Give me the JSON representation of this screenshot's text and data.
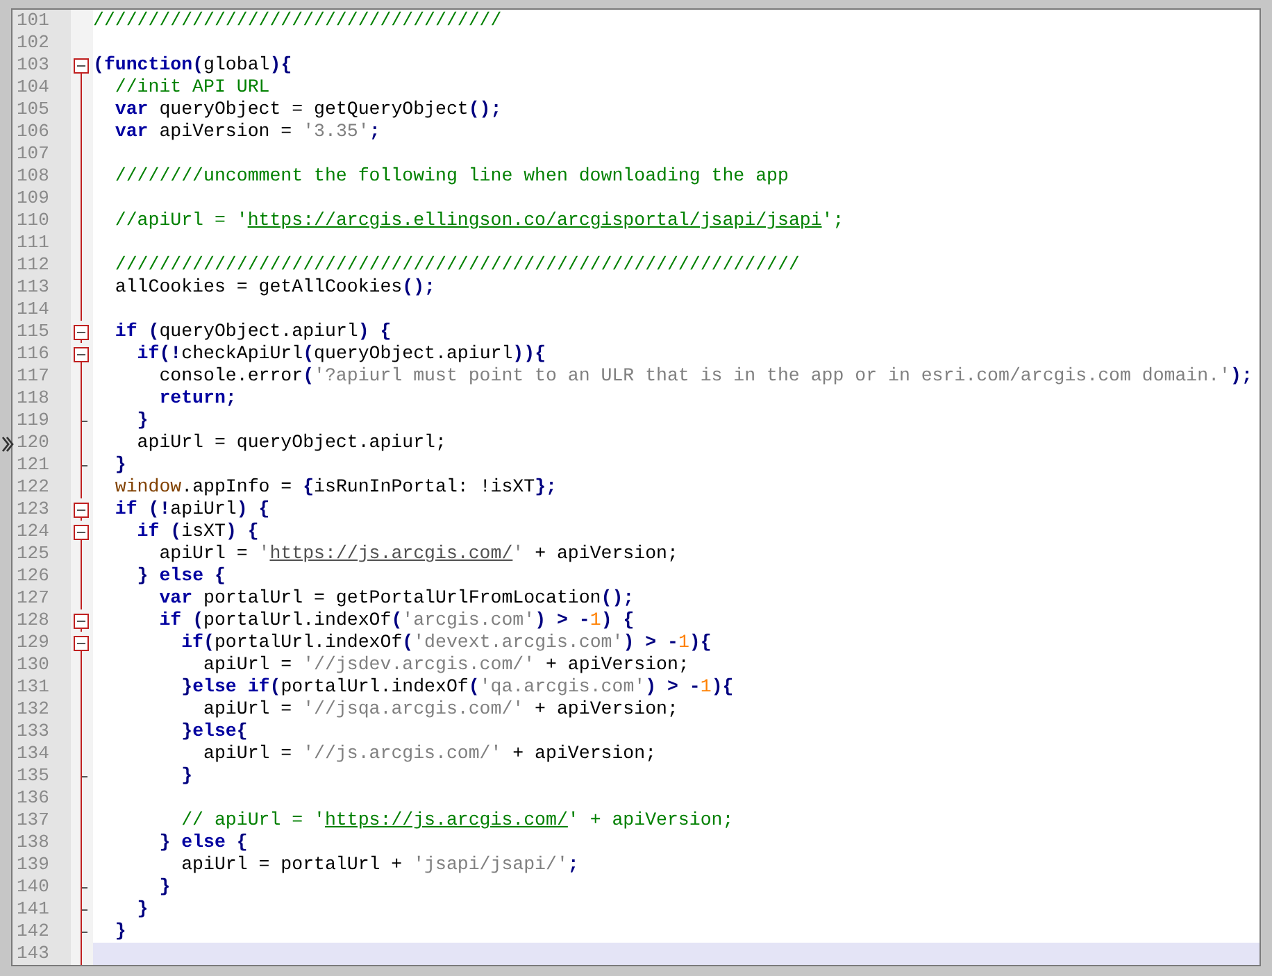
{
  "editor": {
    "lines": [
      {
        "number": "101",
        "kind": "outside",
        "current": false,
        "tokens": [
          {
            "kind": "comment",
            "text": "/////////////////////////////////////"
          }
        ]
      },
      {
        "number": "102",
        "kind": "outside",
        "current": false
      },
      {
        "number": "103",
        "kind": "start",
        "current": false,
        "tokens": [
          {
            "kind": "punct",
            "text": "("
          },
          {
            "kind": "keyword",
            "text": "function"
          },
          {
            "kind": "punct",
            "text": "("
          },
          {
            "kind": "ident",
            "text": "global"
          },
          {
            "kind": "punct",
            "text": "){"
          }
        ]
      },
      {
        "number": "104",
        "kind": "body",
        "current": false,
        "tokens": [
          {
            "kind": "comment",
            "text": "  //init API URL"
          }
        ]
      },
      {
        "number": "105",
        "kind": "body",
        "current": false,
        "tokens": [
          {
            "kind": "keyword",
            "text": "  var"
          },
          {
            "kind": "ident",
            "text": " queryObject = getQueryObject"
          },
          {
            "kind": "punct",
            "text": "();"
          }
        ]
      },
      {
        "number": "106",
        "kind": "body",
        "current": false,
        "tokens": [
          {
            "kind": "keyword",
            "text": "  var"
          },
          {
            "kind": "ident",
            "text": " apiVersion = "
          },
          {
            "kind": "string",
            "text": "'3.35'"
          },
          {
            "kind": "punct",
            "text": ";"
          }
        ]
      },
      {
        "number": "107",
        "kind": "body",
        "current": false
      },
      {
        "number": "108",
        "kind": "body",
        "current": false,
        "tokens": [
          {
            "kind": "comment",
            "text": "  ////////uncomment the following line when downloading the app"
          }
        ]
      },
      {
        "number": "109",
        "kind": "body",
        "current": false
      },
      {
        "number": "110",
        "kind": "body",
        "current": false,
        "tokens": [
          {
            "kind": "comment",
            "text": "  //apiUrl = '"
          },
          {
            "kind": "comment-url",
            "text": "https://arcgis.ellingson.co/arcgisportal/jsapi/jsapi"
          },
          {
            "kind": "comment",
            "text": "';"
          }
        ]
      },
      {
        "number": "111",
        "kind": "body",
        "current": false
      },
      {
        "number": "112",
        "kind": "body",
        "current": false,
        "tokens": [
          {
            "kind": "comment",
            "text": "  //////////////////////////////////////////////////////////////"
          }
        ]
      },
      {
        "number": "113",
        "kind": "body",
        "current": false,
        "tokens": [
          {
            "kind": "ident",
            "text": "  allCookies = getAllCookies"
          },
          {
            "kind": "punct",
            "text": "();"
          }
        ]
      },
      {
        "number": "114",
        "kind": "body",
        "current": false
      },
      {
        "number": "115",
        "kind": "start",
        "current": false,
        "tokens": [
          {
            "kind": "keyword",
            "text": "  if"
          },
          {
            "kind": "punct",
            "text": " ("
          },
          {
            "kind": "ident",
            "text": "queryObject.apiurl"
          },
          {
            "kind": "punct",
            "text": ") {"
          }
        ]
      },
      {
        "number": "116",
        "kind": "start",
        "current": false,
        "tokens": [
          {
            "kind": "keyword",
            "text": "    if"
          },
          {
            "kind": "punct",
            "text": "(!"
          },
          {
            "kind": "ident",
            "text": "checkApiUrl"
          },
          {
            "kind": "punct",
            "text": "("
          },
          {
            "kind": "ident",
            "text": "queryObject.apiurl"
          },
          {
            "kind": "punct",
            "text": ")){"
          }
        ]
      },
      {
        "number": "117",
        "kind": "body",
        "current": false,
        "tokens": [
          {
            "kind": "ident",
            "text": "      console.error"
          },
          {
            "kind": "punct",
            "text": "("
          },
          {
            "kind": "string",
            "text": "'?apiurl must point to an ULR that is in the app or in esri.com/arcgis.com domain.'"
          },
          {
            "kind": "punct",
            "text": ");"
          }
        ]
      },
      {
        "number": "118",
        "kind": "body",
        "current": false,
        "tokens": [
          {
            "kind": "keyword",
            "text": "      return"
          },
          {
            "kind": "punct",
            "text": ";"
          }
        ]
      },
      {
        "number": "119",
        "kind": "end",
        "current": false,
        "tokens": [
          {
            "kind": "punct",
            "text": "    }"
          }
        ]
      },
      {
        "number": "120",
        "kind": "body",
        "current": false,
        "tokens": [
          {
            "kind": "ident",
            "text": "    apiUrl = queryObject.apiurl;"
          }
        ]
      },
      {
        "number": "121",
        "kind": "end",
        "current": false,
        "tokens": [
          {
            "kind": "punct",
            "text": "  }"
          }
        ]
      },
      {
        "number": "122",
        "kind": "body",
        "current": false,
        "tokens": [
          {
            "kind": "global",
            "text": "  window"
          },
          {
            "kind": "ident",
            "text": ".appInfo = "
          },
          {
            "kind": "punct",
            "text": "{"
          },
          {
            "kind": "ident",
            "text": "isRunInPortal: !isXT"
          },
          {
            "kind": "punct",
            "text": "};"
          }
        ]
      },
      {
        "number": "123",
        "kind": "start",
        "current": false,
        "tokens": [
          {
            "kind": "keyword",
            "text": "  if"
          },
          {
            "kind": "punct",
            "text": " (!"
          },
          {
            "kind": "ident",
            "text": "apiUrl"
          },
          {
            "kind": "punct",
            "text": ") {"
          }
        ]
      },
      {
        "number": "124",
        "kind": "start",
        "current": false,
        "tokens": [
          {
            "kind": "keyword",
            "text": "    if"
          },
          {
            "kind": "punct",
            "text": " ("
          },
          {
            "kind": "ident",
            "text": "isXT"
          },
          {
            "kind": "punct",
            "text": ") {"
          }
        ]
      },
      {
        "number": "125",
        "kind": "body",
        "current": false,
        "tokens": [
          {
            "kind": "ident",
            "text": "      apiUrl = "
          },
          {
            "kind": "string",
            "text": "'"
          },
          {
            "kind": "string-url",
            "text": "https://js.arcgis.com/"
          },
          {
            "kind": "string",
            "text": "'"
          },
          {
            "kind": "ident",
            "text": " + apiVersion;"
          }
        ]
      },
      {
        "number": "126",
        "kind": "body",
        "current": false,
        "tokens": [
          {
            "kind": "punct",
            "text": "    } "
          },
          {
            "kind": "keyword",
            "text": "else"
          },
          {
            "kind": "punct",
            "text": " {"
          }
        ]
      },
      {
        "number": "127",
        "kind": "body",
        "current": false,
        "tokens": [
          {
            "kind": "keyword",
            "text": "      var"
          },
          {
            "kind": "ident",
            "text": " portalUrl = getPortalUrlFromLocation"
          },
          {
            "kind": "punct",
            "text": "();"
          }
        ]
      },
      {
        "number": "128",
        "kind": "start",
        "current": false,
        "tokens": [
          {
            "kind": "keyword",
            "text": "      if"
          },
          {
            "kind": "punct",
            "text": " ("
          },
          {
            "kind": "ident",
            "text": "portalUrl.indexOf"
          },
          {
            "kind": "punct",
            "text": "("
          },
          {
            "kind": "string",
            "text": "'arcgis.com'"
          },
          {
            "kind": "punct",
            "text": ") > -"
          },
          {
            "kind": "number",
            "text": "1"
          },
          {
            "kind": "punct",
            "text": ") {"
          }
        ]
      },
      {
        "number": "129",
        "kind": "start",
        "current": false,
        "tokens": [
          {
            "kind": "keyword",
            "text": "        if"
          },
          {
            "kind": "punct",
            "text": "("
          },
          {
            "kind": "ident",
            "text": "portalUrl.indexOf"
          },
          {
            "kind": "punct",
            "text": "("
          },
          {
            "kind": "string",
            "text": "'devext.arcgis.com'"
          },
          {
            "kind": "punct",
            "text": ") > -"
          },
          {
            "kind": "number",
            "text": "1"
          },
          {
            "kind": "punct",
            "text": "){"
          }
        ]
      },
      {
        "number": "130",
        "kind": "body",
        "current": false,
        "tokens": [
          {
            "kind": "ident",
            "text": "          apiUrl = "
          },
          {
            "kind": "string",
            "text": "'//jsdev.arcgis.com/'"
          },
          {
            "kind": "ident",
            "text": " + apiVersion;"
          }
        ]
      },
      {
        "number": "131",
        "kind": "body",
        "current": false,
        "tokens": [
          {
            "kind": "punct",
            "text": "        }"
          },
          {
            "kind": "keyword",
            "text": "else if"
          },
          {
            "kind": "punct",
            "text": "("
          },
          {
            "kind": "ident",
            "text": "portalUrl.indexOf"
          },
          {
            "kind": "punct",
            "text": "("
          },
          {
            "kind": "string",
            "text": "'qa.arcgis.com'"
          },
          {
            "kind": "punct",
            "text": ") > -"
          },
          {
            "kind": "number",
            "text": "1"
          },
          {
            "kind": "punct",
            "text": "){"
          }
        ]
      },
      {
        "number": "132",
        "kind": "body",
        "current": false,
        "tokens": [
          {
            "kind": "ident",
            "text": "          apiUrl = "
          },
          {
            "kind": "string",
            "text": "'//jsqa.arcgis.com/'"
          },
          {
            "kind": "ident",
            "text": " + apiVersion;"
          }
        ]
      },
      {
        "number": "133",
        "kind": "body",
        "current": false,
        "tokens": [
          {
            "kind": "punct",
            "text": "        }"
          },
          {
            "kind": "keyword",
            "text": "else"
          },
          {
            "kind": "punct",
            "text": "{"
          }
        ]
      },
      {
        "number": "134",
        "kind": "body",
        "current": false,
        "tokens": [
          {
            "kind": "ident",
            "text": "          apiUrl = "
          },
          {
            "kind": "string",
            "text": "'//js.arcgis.com/'"
          },
          {
            "kind": "ident",
            "text": " + apiVersion;"
          }
        ]
      },
      {
        "number": "135",
        "kind": "end",
        "current": false,
        "tokens": [
          {
            "kind": "punct",
            "text": "        }"
          }
        ]
      },
      {
        "number": "136",
        "kind": "body",
        "current": false
      },
      {
        "number": "137",
        "kind": "body",
        "current": false,
        "tokens": [
          {
            "kind": "comment",
            "text": "        // apiUrl = '"
          },
          {
            "kind": "comment-url",
            "text": "https://js.arcgis.com/"
          },
          {
            "kind": "comment",
            "text": "' + apiVersion;"
          }
        ]
      },
      {
        "number": "138",
        "kind": "body",
        "current": false,
        "tokens": [
          {
            "kind": "punct",
            "text": "      } "
          },
          {
            "kind": "keyword",
            "text": "else"
          },
          {
            "kind": "punct",
            "text": " {"
          }
        ]
      },
      {
        "number": "139",
        "kind": "body",
        "current": false,
        "tokens": [
          {
            "kind": "ident",
            "text": "        apiUrl = portalUrl + "
          },
          {
            "kind": "string",
            "text": "'jsapi/jsapi/'"
          },
          {
            "kind": "punct",
            "text": ";"
          }
        ]
      },
      {
        "number": "140",
        "kind": "end",
        "current": false,
        "tokens": [
          {
            "kind": "punct",
            "text": "      }"
          }
        ]
      },
      {
        "number": "141",
        "kind": "end",
        "current": false,
        "tokens": [
          {
            "kind": "punct",
            "text": "    }"
          }
        ]
      },
      {
        "number": "142",
        "kind": "end",
        "current": false,
        "tokens": [
          {
            "kind": "punct",
            "text": "  }"
          }
        ]
      },
      {
        "number": "143",
        "kind": "body",
        "current": true
      }
    ]
  }
}
